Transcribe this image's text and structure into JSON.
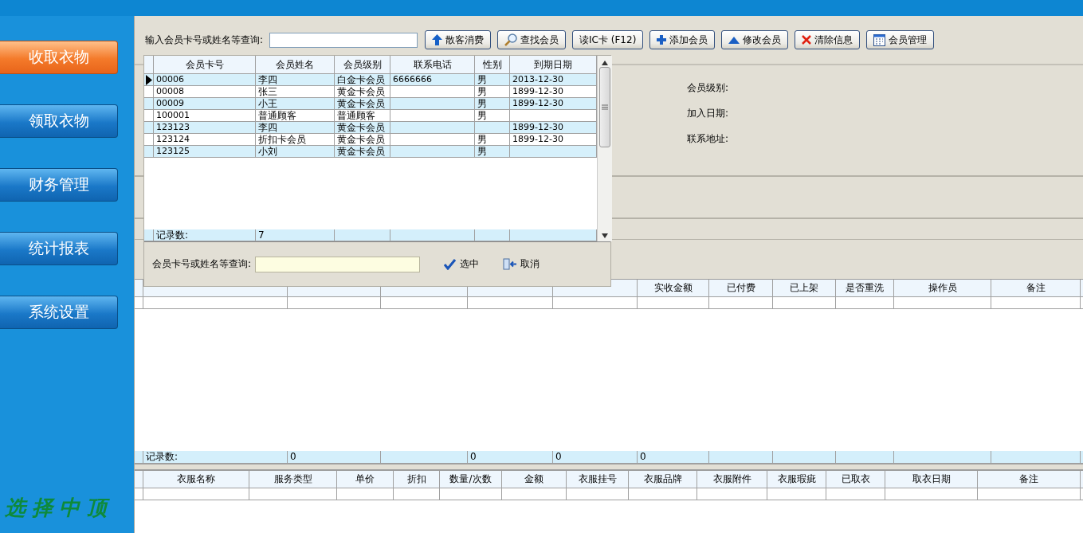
{
  "sidebar": {
    "items": [
      {
        "label": "收取衣物",
        "selected": true
      },
      {
        "label": "领取衣物",
        "selected": false
      },
      {
        "label": "财务管理",
        "selected": false
      },
      {
        "label": "统计报表",
        "selected": false
      },
      {
        "label": "系统设置",
        "selected": false
      }
    ],
    "logo": "选择中顶"
  },
  "toolbar": {
    "search_label": "输入会员卡号或姓名等查询:",
    "buttons": [
      {
        "label": "散客消费",
        "kind": "up"
      },
      {
        "label": "查找会员",
        "kind": "search"
      },
      {
        "label": "读IC卡 (F12)",
        "kind": "plain"
      },
      {
        "label": "添加会员",
        "kind": "plus"
      },
      {
        "label": "修改会员",
        "kind": "triangle"
      },
      {
        "label": "清除信息",
        "kind": "clear"
      },
      {
        "label": "会员管理",
        "kind": "calendar"
      }
    ]
  },
  "member_info": {
    "labels": [
      "会员级别:",
      "加入日期:",
      "联系地址:"
    ]
  },
  "order_grid": {
    "columns": [
      {},
      {},
      {},
      {},
      {},
      {
        "label": "实收金额"
      },
      {
        "label": "已付费"
      },
      {
        "label": "已上架"
      },
      {
        "label": "是否重洗"
      },
      {
        "label": "操作员"
      },
      {
        "label": "备注"
      }
    ],
    "footer": {
      "column_1": "记录数:",
      "column_2": "0",
      "column_4": "0",
      "column_5": "0",
      "column_6": "0"
    }
  },
  "item_grid": {
    "columns": [
      "衣服名称",
      "服务类型",
      "单价",
      "折扣",
      "数量/次数",
      "金额",
      "衣服挂号",
      "衣服品牌",
      "衣服附件",
      "衣服瑕疵",
      "已取衣",
      "取衣日期",
      "备注"
    ]
  },
  "member_popup": {
    "columns": [
      "会员卡号",
      "会员姓名",
      "会员级别",
      "联系电话",
      "性别",
      "到期日期"
    ],
    "rows": [
      {
        "card_no": "00006",
        "name": "李四",
        "level": "白金卡会员",
        "phone": "6666666",
        "gender": "男",
        "expiry": "2013-12-30",
        "selected": true
      },
      {
        "card_no": "00008",
        "name": "张三",
        "level": "黄金卡会员",
        "gender": "男",
        "expiry": "1899-12-30",
        "selected": false
      },
      {
        "card_no": "00009",
        "name": "小王",
        "level": "黄金卡会员",
        "gender": "男",
        "expiry": "1899-12-30",
        "selected": false
      },
      {
        "card_no": "100001",
        "name": "普通顾客",
        "level": "普通顾客",
        "gender": "男",
        "selected": false
      },
      {
        "card_no": "123123",
        "name": "李四",
        "level": "黄金卡会员",
        "expiry": "1899-12-30",
        "selected": false
      },
      {
        "card_no": "123124",
        "name": "折扣卡会员",
        "level": "黄金卡会员",
        "gender": "男",
        "expiry": "1899-12-30",
        "selected": false
      },
      {
        "card_no": "123125",
        "name": "小刘",
        "level": "黄金卡会员",
        "gender": "男",
        "selected": false
      }
    ],
    "footer": {
      "label": "记录数:",
      "count": "7"
    },
    "search_label": "会员卡号或姓名等查询:",
    "buttons": [
      {
        "label": "选中",
        "kind": "check"
      },
      {
        "label": "取消",
        "kind": "exit"
      }
    ]
  }
}
